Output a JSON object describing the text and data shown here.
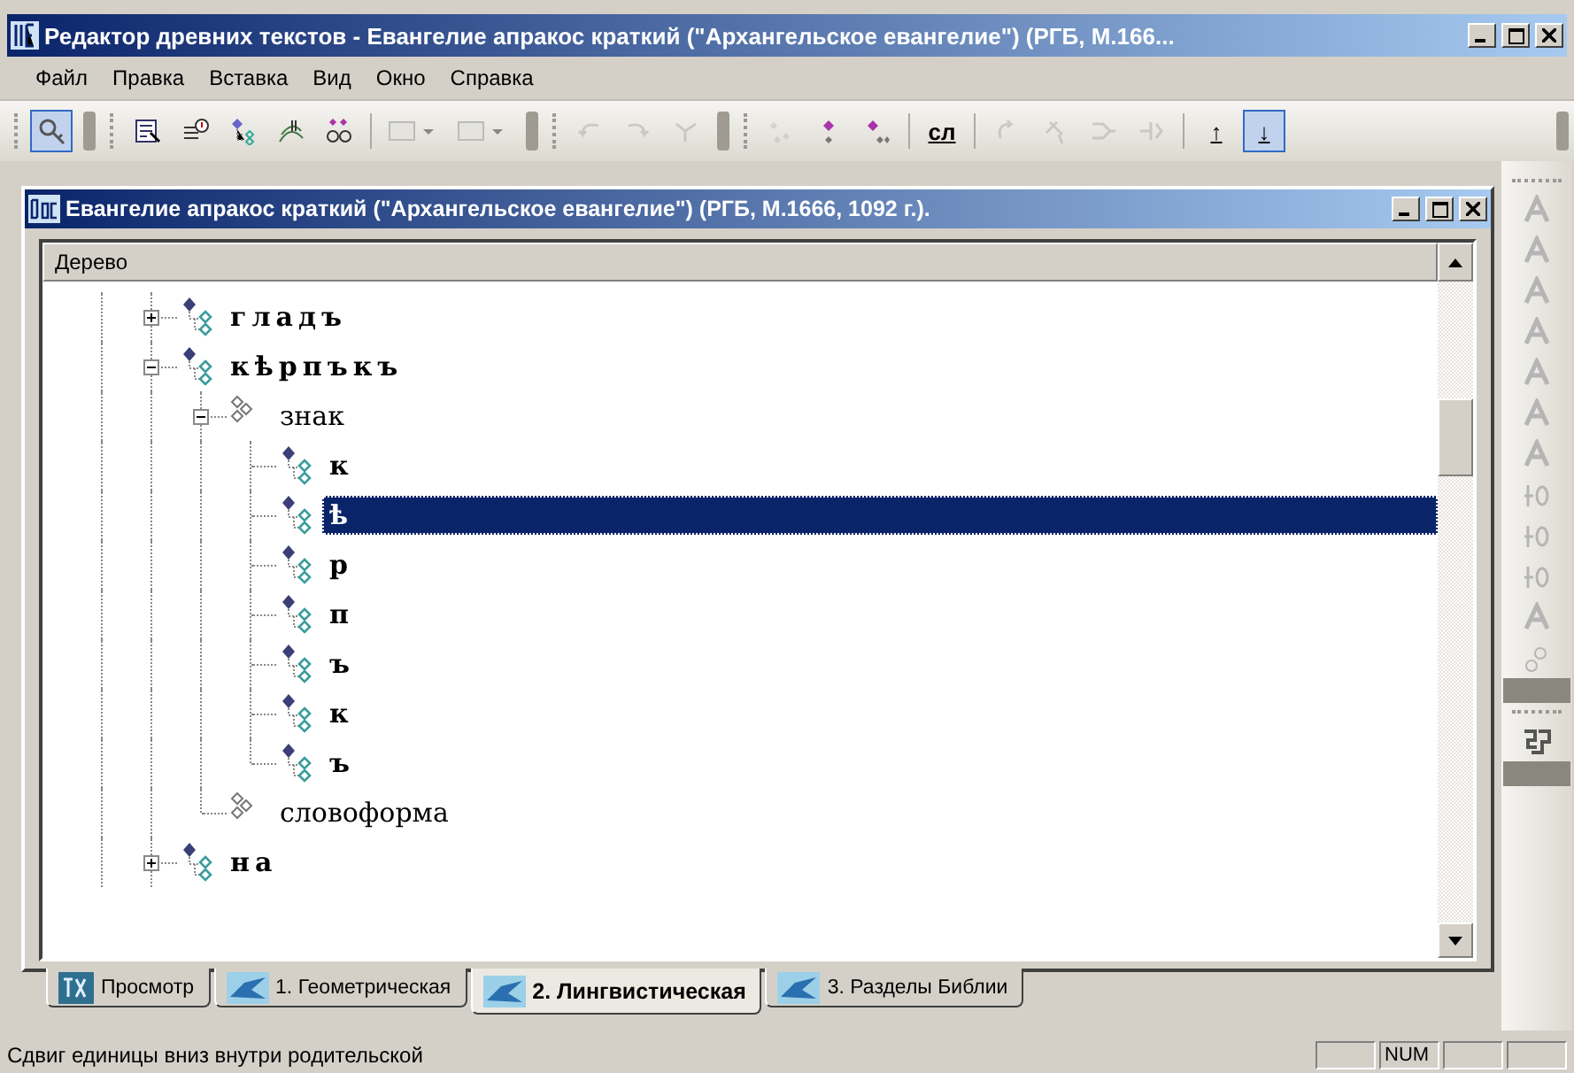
{
  "window": {
    "title": "Редактор древних текстов - Евангелие апракос краткий (\"Архангельское евангелие\") (РГБ, М.166..."
  },
  "menu": [
    {
      "label": "Файл"
    },
    {
      "label": "Правка"
    },
    {
      "label": "Вставка"
    },
    {
      "label": "Вид"
    },
    {
      "label": "Окно"
    },
    {
      "label": "Справка"
    }
  ],
  "toolbar": {
    "groups": [
      {
        "items": [
          {
            "kind": "icon",
            "pressed": true,
            "disabled": false
          }
        ]
      },
      {
        "items": [
          {
            "kind": "icon",
            "pressed": false,
            "disabled": false
          },
          {
            "kind": "icon",
            "pressed": false,
            "disabled": false
          },
          {
            "kind": "icon",
            "pressed": false,
            "disabled": false
          },
          {
            "kind": "icon",
            "pressed": false,
            "disabled": false
          },
          {
            "kind": "icon",
            "pressed": false,
            "disabled": false
          },
          {
            "kind": "separator"
          },
          {
            "kind": "dropdown",
            "disabled": true
          },
          {
            "kind": "dropdown",
            "disabled": true
          }
        ]
      },
      {
        "items": [
          {
            "kind": "icon",
            "pressed": false,
            "disabled": true
          },
          {
            "kind": "icon",
            "pressed": false,
            "disabled": true
          },
          {
            "kind": "icon",
            "pressed": false,
            "disabled": true
          }
        ]
      },
      {
        "items": [
          {
            "kind": "icon",
            "pressed": false,
            "disabled": true
          },
          {
            "kind": "icon",
            "pressed": false,
            "disabled": false
          },
          {
            "kind": "icon",
            "pressed": false,
            "disabled": false
          },
          {
            "kind": "separator"
          },
          {
            "kind": "text",
            "label": "сл",
            "pressed": false,
            "disabled": false
          },
          {
            "kind": "separator"
          },
          {
            "kind": "icon",
            "pressed": false,
            "disabled": true
          },
          {
            "kind": "icon",
            "pressed": false,
            "disabled": true
          },
          {
            "kind": "icon",
            "pressed": false,
            "disabled": true
          },
          {
            "kind": "icon",
            "pressed": false,
            "disabled": true
          },
          {
            "kind": "separator"
          },
          {
            "kind": "text",
            "label": "↑",
            "pressed": false,
            "disabled": false
          },
          {
            "kind": "text",
            "label": "↓",
            "pressed": true,
            "disabled": false
          }
        ]
      }
    ]
  },
  "document": {
    "title": "Евангелие апракос краткий (\"Архангельское евангелие\") (РГБ, М.1666, 1092 г.).",
    "tree": {
      "header": "Дерево",
      "nodes": [
        {
          "label": "гладъ",
          "kind": "unit",
          "expanded": false,
          "selected": false
        },
        {
          "label": "кѣрпъкъ",
          "kind": "unit",
          "expanded": true,
          "selected": false,
          "children": [
            {
              "label": "знак",
              "kind": "category",
              "expanded": true,
              "selected": false,
              "children": [
                {
                  "label": "к",
                  "kind": "unit",
                  "selected": false
                },
                {
                  "label": "ѣ",
                  "kind": "unit",
                  "selected": true
                },
                {
                  "label": "р",
                  "kind": "unit",
                  "selected": false
                },
                {
                  "label": "п",
                  "kind": "unit",
                  "selected": false
                },
                {
                  "label": "ъ",
                  "kind": "unit",
                  "selected": false
                },
                {
                  "label": "к",
                  "kind": "unit",
                  "selected": false
                },
                {
                  "label": "ъ",
                  "kind": "unit",
                  "selected": false
                }
              ]
            },
            {
              "label": "словоформа",
              "kind": "category",
              "selected": false
            }
          ]
        },
        {
          "label": "на",
          "kind": "unit",
          "expanded": false,
          "selected": false
        }
      ]
    },
    "tabs": [
      {
        "label": "Просмотр",
        "kind": "text",
        "selected": false
      },
      {
        "label": "1. Геометрическая",
        "kind": "diagram",
        "selected": false
      },
      {
        "label": "2. Лингвистическая",
        "kind": "diagram",
        "selected": true
      },
      {
        "label": "3. Разделы Библии",
        "kind": "diagram",
        "selected": false
      }
    ]
  },
  "side_toolbar": {
    "groups": [
      {
        "items": [
          {
            "kind": "icon",
            "disabled": true
          },
          {
            "kind": "icon",
            "disabled": true
          },
          {
            "kind": "icon",
            "disabled": true
          },
          {
            "kind": "icon",
            "disabled": true
          },
          {
            "kind": "icon",
            "disabled": true
          },
          {
            "kind": "icon",
            "disabled": true
          },
          {
            "kind": "icon",
            "disabled": true
          },
          {
            "kind": "icon",
            "disabled": true
          },
          {
            "kind": "icon",
            "disabled": true
          },
          {
            "kind": "icon",
            "disabled": true
          },
          {
            "kind": "icon",
            "disabled": true
          },
          {
            "kind": "icon",
            "disabled": true
          }
        ]
      },
      {
        "items": [
          {
            "kind": "icon",
            "disabled": false
          }
        ]
      }
    ]
  },
  "status_bar": {
    "message": "Сдвиг единицы вниз внутри родительской",
    "panels": [
      {
        "kind": "empty"
      },
      {
        "kind": "text",
        "text": "NUM"
      },
      {
        "kind": "empty"
      },
      {
        "kind": "empty"
      }
    ]
  }
}
